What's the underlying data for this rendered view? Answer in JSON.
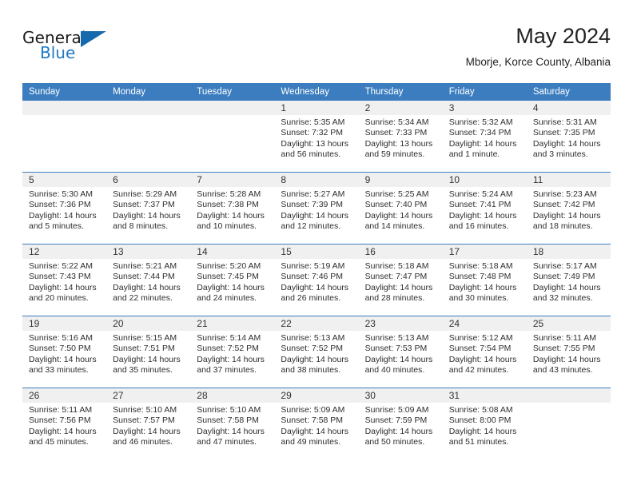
{
  "brand": {
    "name_top": "General",
    "name_bottom": "Blue",
    "accent_color": "#2079c4",
    "triangle_color": "#1769ad"
  },
  "header": {
    "title": "May 2024",
    "subtitle": "Mborje, Korce County, Albania"
  },
  "theme": {
    "header_row_bg": "#3b7dbf",
    "header_row_text": "#ffffff",
    "daynum_band_bg": "#f0f0f0",
    "row_divider": "#3b7dbf",
    "body_text": "#2e2e2e"
  },
  "weekdays": [
    "Sunday",
    "Monday",
    "Tuesday",
    "Wednesday",
    "Thursday",
    "Friday",
    "Saturday"
  ],
  "weeks": [
    [
      {
        "day": "",
        "lines": []
      },
      {
        "day": "",
        "lines": []
      },
      {
        "day": "",
        "lines": []
      },
      {
        "day": "1",
        "lines": [
          "Sunrise: 5:35 AM",
          "Sunset: 7:32 PM",
          "Daylight: 13 hours",
          "and 56 minutes."
        ]
      },
      {
        "day": "2",
        "lines": [
          "Sunrise: 5:34 AM",
          "Sunset: 7:33 PM",
          "Daylight: 13 hours",
          "and 59 minutes."
        ]
      },
      {
        "day": "3",
        "lines": [
          "Sunrise: 5:32 AM",
          "Sunset: 7:34 PM",
          "Daylight: 14 hours",
          "and 1 minute."
        ]
      },
      {
        "day": "4",
        "lines": [
          "Sunrise: 5:31 AM",
          "Sunset: 7:35 PM",
          "Daylight: 14 hours",
          "and 3 minutes."
        ]
      }
    ],
    [
      {
        "day": "5",
        "lines": [
          "Sunrise: 5:30 AM",
          "Sunset: 7:36 PM",
          "Daylight: 14 hours",
          "and 5 minutes."
        ]
      },
      {
        "day": "6",
        "lines": [
          "Sunrise: 5:29 AM",
          "Sunset: 7:37 PM",
          "Daylight: 14 hours",
          "and 8 minutes."
        ]
      },
      {
        "day": "7",
        "lines": [
          "Sunrise: 5:28 AM",
          "Sunset: 7:38 PM",
          "Daylight: 14 hours",
          "and 10 minutes."
        ]
      },
      {
        "day": "8",
        "lines": [
          "Sunrise: 5:27 AM",
          "Sunset: 7:39 PM",
          "Daylight: 14 hours",
          "and 12 minutes."
        ]
      },
      {
        "day": "9",
        "lines": [
          "Sunrise: 5:25 AM",
          "Sunset: 7:40 PM",
          "Daylight: 14 hours",
          "and 14 minutes."
        ]
      },
      {
        "day": "10",
        "lines": [
          "Sunrise: 5:24 AM",
          "Sunset: 7:41 PM",
          "Daylight: 14 hours",
          "and 16 minutes."
        ]
      },
      {
        "day": "11",
        "lines": [
          "Sunrise: 5:23 AM",
          "Sunset: 7:42 PM",
          "Daylight: 14 hours",
          "and 18 minutes."
        ]
      }
    ],
    [
      {
        "day": "12",
        "lines": [
          "Sunrise: 5:22 AM",
          "Sunset: 7:43 PM",
          "Daylight: 14 hours",
          "and 20 minutes."
        ]
      },
      {
        "day": "13",
        "lines": [
          "Sunrise: 5:21 AM",
          "Sunset: 7:44 PM",
          "Daylight: 14 hours",
          "and 22 minutes."
        ]
      },
      {
        "day": "14",
        "lines": [
          "Sunrise: 5:20 AM",
          "Sunset: 7:45 PM",
          "Daylight: 14 hours",
          "and 24 minutes."
        ]
      },
      {
        "day": "15",
        "lines": [
          "Sunrise: 5:19 AM",
          "Sunset: 7:46 PM",
          "Daylight: 14 hours",
          "and 26 minutes."
        ]
      },
      {
        "day": "16",
        "lines": [
          "Sunrise: 5:18 AM",
          "Sunset: 7:47 PM",
          "Daylight: 14 hours",
          "and 28 minutes."
        ]
      },
      {
        "day": "17",
        "lines": [
          "Sunrise: 5:18 AM",
          "Sunset: 7:48 PM",
          "Daylight: 14 hours",
          "and 30 minutes."
        ]
      },
      {
        "day": "18",
        "lines": [
          "Sunrise: 5:17 AM",
          "Sunset: 7:49 PM",
          "Daylight: 14 hours",
          "and 32 minutes."
        ]
      }
    ],
    [
      {
        "day": "19",
        "lines": [
          "Sunrise: 5:16 AM",
          "Sunset: 7:50 PM",
          "Daylight: 14 hours",
          "and 33 minutes."
        ]
      },
      {
        "day": "20",
        "lines": [
          "Sunrise: 5:15 AM",
          "Sunset: 7:51 PM",
          "Daylight: 14 hours",
          "and 35 minutes."
        ]
      },
      {
        "day": "21",
        "lines": [
          "Sunrise: 5:14 AM",
          "Sunset: 7:52 PM",
          "Daylight: 14 hours",
          "and 37 minutes."
        ]
      },
      {
        "day": "22",
        "lines": [
          "Sunrise: 5:13 AM",
          "Sunset: 7:52 PM",
          "Daylight: 14 hours",
          "and 38 minutes."
        ]
      },
      {
        "day": "23",
        "lines": [
          "Sunrise: 5:13 AM",
          "Sunset: 7:53 PM",
          "Daylight: 14 hours",
          "and 40 minutes."
        ]
      },
      {
        "day": "24",
        "lines": [
          "Sunrise: 5:12 AM",
          "Sunset: 7:54 PM",
          "Daylight: 14 hours",
          "and 42 minutes."
        ]
      },
      {
        "day": "25",
        "lines": [
          "Sunrise: 5:11 AM",
          "Sunset: 7:55 PM",
          "Daylight: 14 hours",
          "and 43 minutes."
        ]
      }
    ],
    [
      {
        "day": "26",
        "lines": [
          "Sunrise: 5:11 AM",
          "Sunset: 7:56 PM",
          "Daylight: 14 hours",
          "and 45 minutes."
        ]
      },
      {
        "day": "27",
        "lines": [
          "Sunrise: 5:10 AM",
          "Sunset: 7:57 PM",
          "Daylight: 14 hours",
          "and 46 minutes."
        ]
      },
      {
        "day": "28",
        "lines": [
          "Sunrise: 5:10 AM",
          "Sunset: 7:58 PM",
          "Daylight: 14 hours",
          "and 47 minutes."
        ]
      },
      {
        "day": "29",
        "lines": [
          "Sunrise: 5:09 AM",
          "Sunset: 7:58 PM",
          "Daylight: 14 hours",
          "and 49 minutes."
        ]
      },
      {
        "day": "30",
        "lines": [
          "Sunrise: 5:09 AM",
          "Sunset: 7:59 PM",
          "Daylight: 14 hours",
          "and 50 minutes."
        ]
      },
      {
        "day": "31",
        "lines": [
          "Sunrise: 5:08 AM",
          "Sunset: 8:00 PM",
          "Daylight: 14 hours",
          "and 51 minutes."
        ]
      },
      {
        "day": "",
        "lines": []
      }
    ]
  ]
}
